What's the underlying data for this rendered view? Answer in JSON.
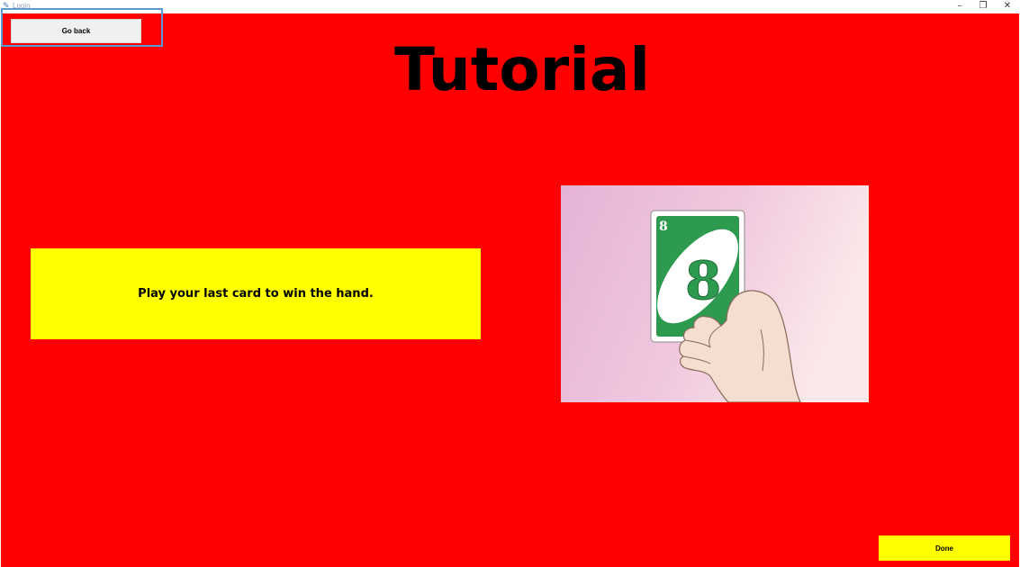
{
  "window": {
    "title": "Login",
    "minimize_glyph": "–",
    "maximize_glyph": "❐",
    "close_glyph": "✕",
    "app_icon": "feather-icon"
  },
  "toolbar": {
    "go_back_label": "Go back"
  },
  "page": {
    "title": "Tutorial",
    "instruction": "Play your last card to win the hand.",
    "background_color": "#ff0000",
    "accent_color": "#ffff00"
  },
  "illustration": {
    "icon": "hand-holding-card-icon",
    "card_number": "8",
    "card_color": "#2e9a4f"
  },
  "footer": {
    "done_label": "Done"
  }
}
